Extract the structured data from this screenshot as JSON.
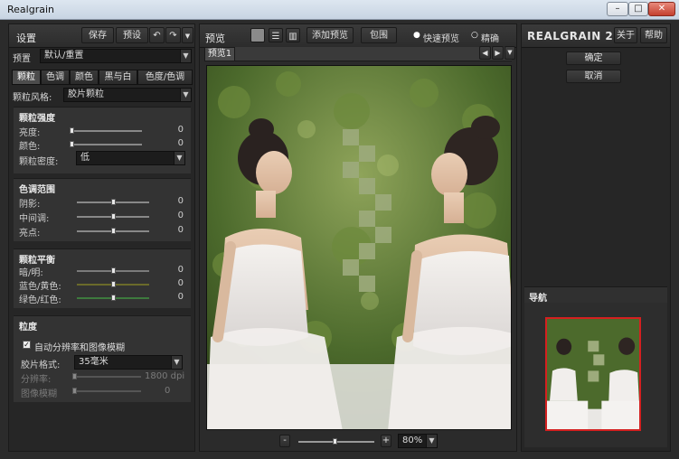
{
  "window": {
    "title": "Realgrain",
    "min": "–",
    "max": "□",
    "close": "✕"
  },
  "left": {
    "header": "设置",
    "save": "保存",
    "preset_btn": "预设",
    "preset_label": "预置",
    "preset_value": "默认/重置",
    "tabs": [
      "颗粒",
      "色调",
      "颜色",
      "黑与白",
      "色度/色调"
    ],
    "grain_style_label": "颗粒风格:",
    "grain_style_value": "胶片颗粒",
    "grain_strength": {
      "title": "颗粒强度",
      "rows": [
        {
          "label": "亮度:",
          "value": "0",
          "pos": 0.0
        },
        {
          "label": "颜色:",
          "value": "0",
          "pos": 0.0
        }
      ],
      "density_label": "颗粒密度:",
      "density_value": "低"
    },
    "tone_range": {
      "title": "色调范围",
      "rows": [
        {
          "label": "阴影:",
          "value": "0",
          "pos": 0.5
        },
        {
          "label": "中间调:",
          "value": "0",
          "pos": 0.5
        },
        {
          "label": "亮点:",
          "value": "0",
          "pos": 0.5
        }
      ]
    },
    "grain_balance": {
      "title": "颗粒平衡",
      "rows": [
        {
          "label": "暗/明:",
          "value": "0",
          "pos": 0.5,
          "track": "#7a7a7a"
        },
        {
          "label": "蓝色/黄色:",
          "value": "0",
          "pos": 0.5,
          "track": "#6a6a2a"
        },
        {
          "label": "绿色/红色:",
          "value": "0",
          "pos": 0.5,
          "track": "#3e7a3e"
        }
      ]
    },
    "granularity": {
      "title": "粒度",
      "auto_label": "自动分辨率和图像模糊",
      "film_format_label": "胶片格式:",
      "film_format_value": "35毫米",
      "resolution_label": "分辨率:",
      "resolution_value": "1800 dpi",
      "blur_label": "图像模糊",
      "blur_value": "0"
    }
  },
  "center": {
    "header": "预览",
    "add_preview": "添加预览",
    "bracket": "包围",
    "fast_preview": "快速预览",
    "accurate": "精确",
    "tab": "预览1",
    "zoom_minus": "-",
    "zoom_plus": "+",
    "zoom_value": "80%",
    "zoom_pos": 0.5
  },
  "right": {
    "brand": "REALGRAIN 2",
    "about": "关于",
    "help": "帮助",
    "ok": "确定",
    "cancel": "取消",
    "navigator": "导航"
  }
}
